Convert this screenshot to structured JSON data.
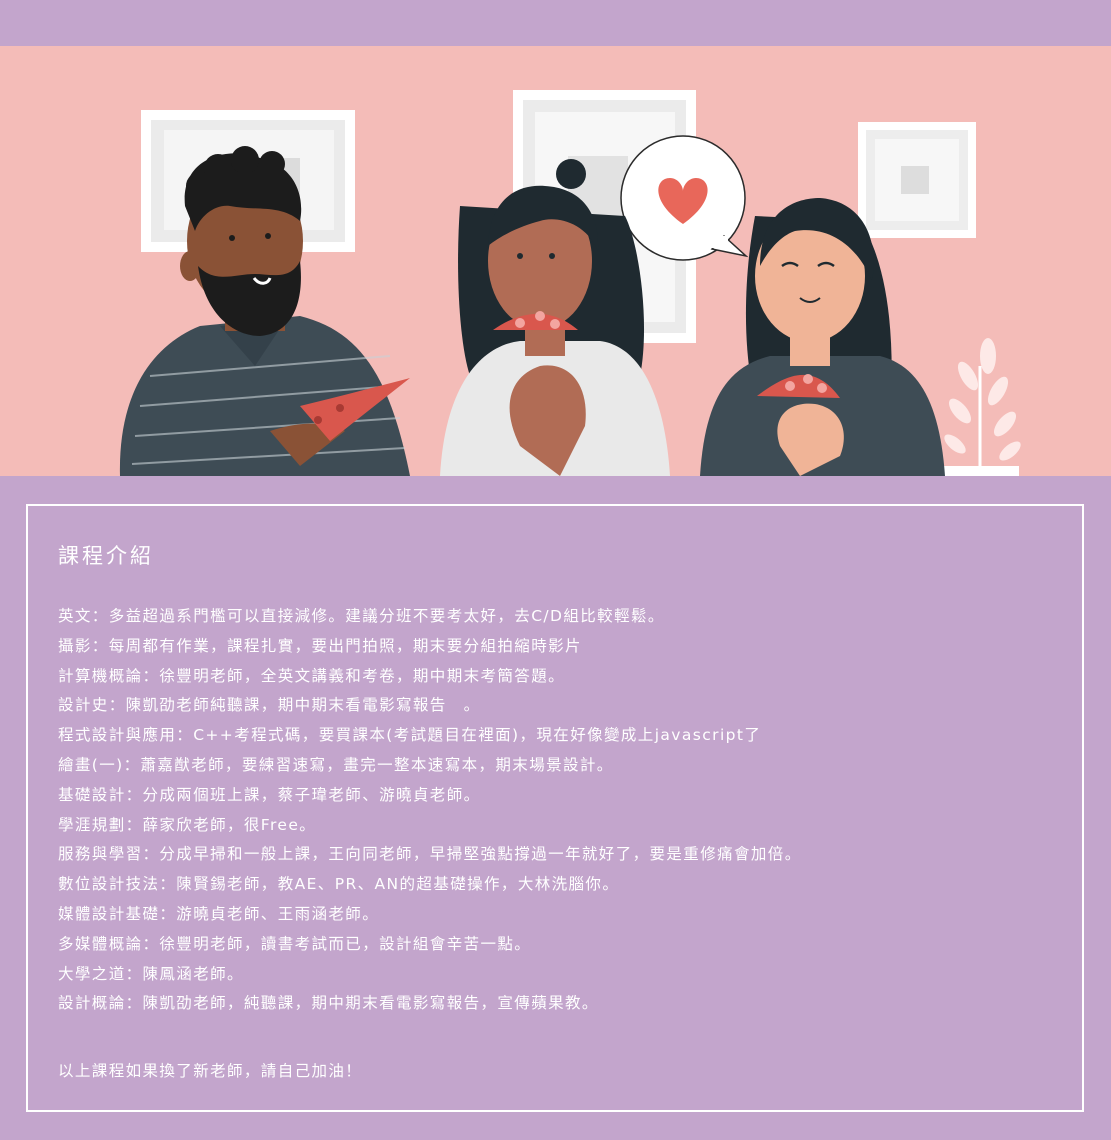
{
  "colors": {
    "background": "#c3a5cc",
    "hero_wall": "#f4bcb8",
    "text": "#ffffff",
    "heart": "#e8675a"
  },
  "illustration": {
    "subject": "three-friends-eating-pizza",
    "icons": [
      "picture-frame-icon",
      "heart-speech-bubble-icon",
      "pizza-slice-icon",
      "potted-plant-icon"
    ]
  },
  "section": {
    "title": "課程介紹",
    "courses": [
      "英文：多益超過系門檻可以直接減修。建議分班不要考太好，去C/D組比較輕鬆。",
      "攝影：每周都有作業，課程扎實，要出門拍照，期末要分組拍縮時影片",
      "計算機概論：徐豐明老師，全英文講義和考卷，期中期末考簡答題。",
      "設計史：陳凱劭老師純聽課，期中期末看電影寫報告　。",
      "程式設計與應用：C++考程式碼，要買課本(考試題目在裡面)，現在好像變成上javascript了",
      "繪畫(一)：蕭嘉猷老師，要練習速寫，畫完一整本速寫本，期末場景設計。",
      "基礎設計：分成兩個班上課，蔡子瑋老師、游曉貞老師。",
      "學涯規劃：薛家欣老師，很Free。",
      "服務與學習：分成早掃和一般上課，王向同老師，早掃堅強點撐過一年就好了，要是重修痛會加倍。",
      "數位設計技法：陳賢錫老師，教AE、PR、AN的超基礎操作，大林洗腦你。",
      "媒體設計基礎：游曉貞老師、王雨涵老師。",
      "多媒體概論：徐豐明老師，讀書考試而已，設計組會辛苦一點。",
      "大學之道：陳鳳涵老師。",
      "設計概論：陳凱劭老師，純聽課，期中期末看電影寫報告，宣傳蘋果教。"
    ],
    "footer": "以上課程如果換了新老師，請自己加油！"
  }
}
